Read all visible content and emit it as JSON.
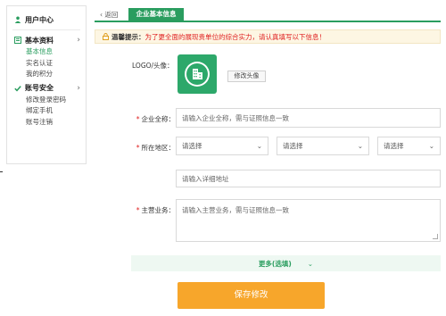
{
  "sidebar": {
    "header": "用户中心",
    "sections": [
      {
        "title": "基本资料",
        "items": [
          "基本信息",
          "实名认证",
          "我的积分"
        ],
        "active": 0
      },
      {
        "title": "账号安全",
        "items": [
          "修改登录密码",
          "绑定手机",
          "账号注销"
        ],
        "active": -1
      }
    ]
  },
  "tabs": {
    "back": "返回",
    "active": "企业基本信息"
  },
  "notice": {
    "label": "温馨提示：",
    "text": "为了更全面的展现贵单位的综合实力，请认真填写以下信息！"
  },
  "form": {
    "logo_label": "LOGO/头像：",
    "logo_button": "修改头像",
    "name_label": "企业全称：",
    "name_placeholder": "请输入企业全称，需与证照信息一致",
    "region_label": "所在地区：",
    "select_placeholder": "请选择",
    "address_placeholder": "请输入详细地址",
    "business_label": "主营业务：",
    "business_placeholder": "请输入主营业务，需与证照信息一致",
    "more": "更多(选填)",
    "save": "保存修改"
  },
  "colors": {
    "accent": "#2a9d5f",
    "save": "#f7a62b",
    "required": "#e02020"
  }
}
